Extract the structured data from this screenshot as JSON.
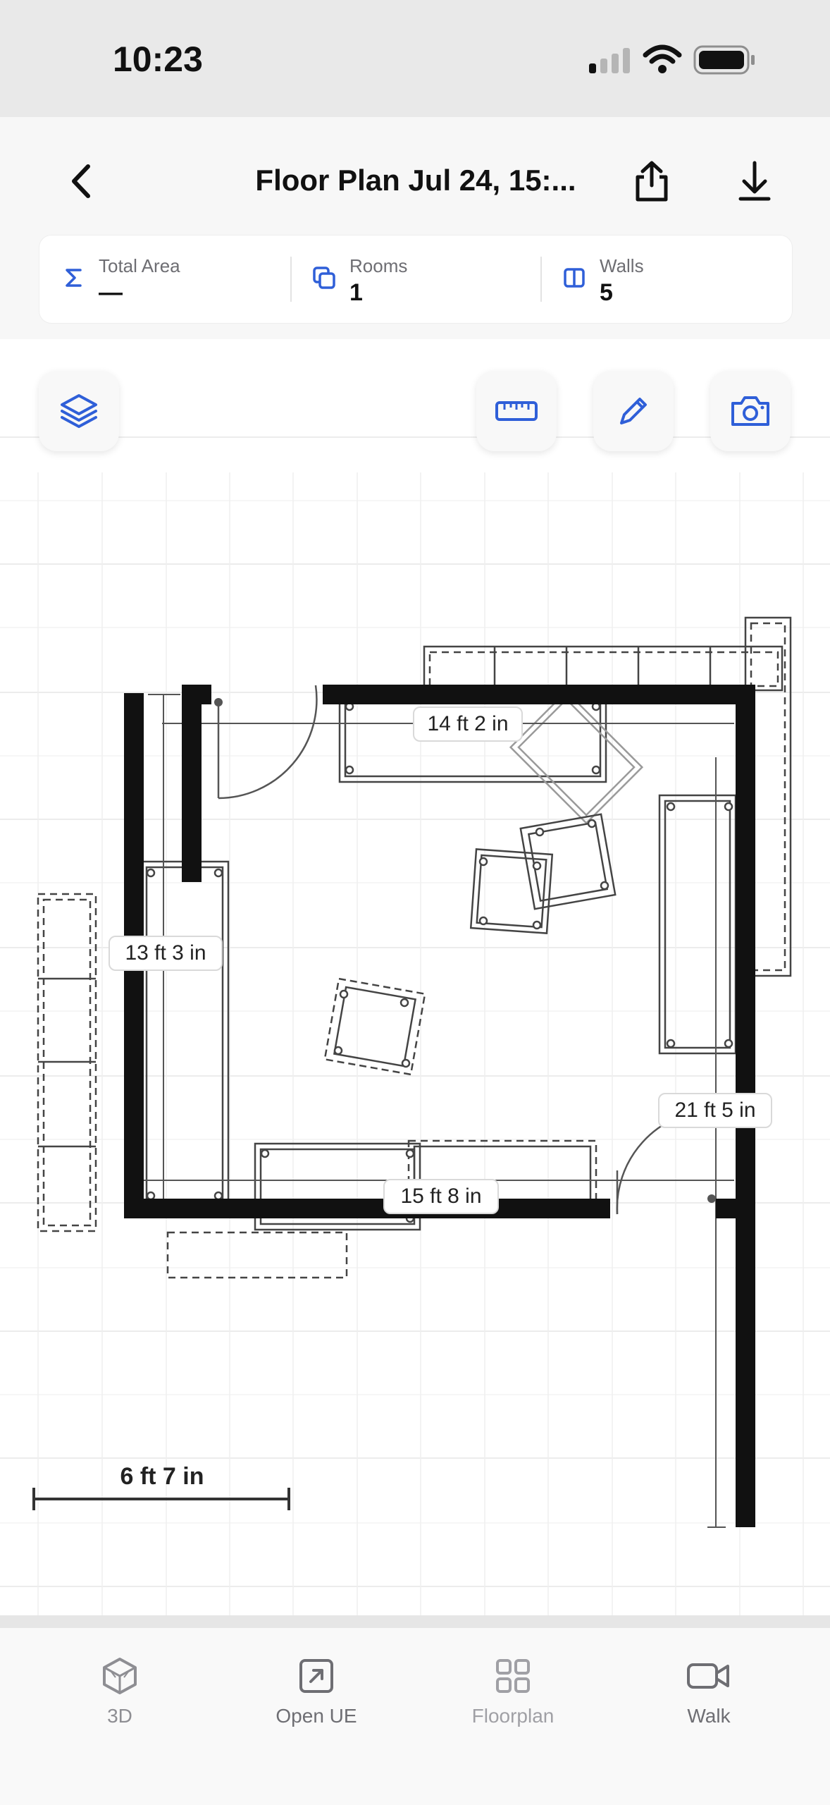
{
  "status": {
    "time": "10:23"
  },
  "header": {
    "title": "Floor Plan Jul 24, 15:..."
  },
  "stats": [
    {
      "label": "Total Area",
      "value": "—",
      "icon": "sigma-icon"
    },
    {
      "label": "Rooms",
      "value": "1",
      "icon": "rooms-icon"
    },
    {
      "label": "Walls",
      "value": "5",
      "icon": "walls-icon"
    }
  ],
  "toolbar": {
    "icons": [
      "layers-icon",
      "ruler-icon",
      "pencil-icon",
      "camera-icon"
    ]
  },
  "plan": {
    "dimensions": {
      "top_wall": "14 ft 2 in",
      "left_wall": "13 ft 3 in",
      "bottom_wall": "15 ft 8 in",
      "right_wall": "21 ft 5 in"
    },
    "scale_label": "6 ft 7 in"
  },
  "tabs": [
    {
      "label": "3D",
      "icon": "cube-icon",
      "color": "#8e8e93"
    },
    {
      "label": "Open UE",
      "icon": "open-external-icon",
      "color": "#6e6e73"
    },
    {
      "label": "Floorplan",
      "icon": "grid-icon",
      "color": "#a0a0a5"
    },
    {
      "label": "Walk",
      "icon": "video-camera-icon",
      "color": "#6e6e73"
    }
  ],
  "colors": {
    "accent": "#2f5fd8"
  }
}
